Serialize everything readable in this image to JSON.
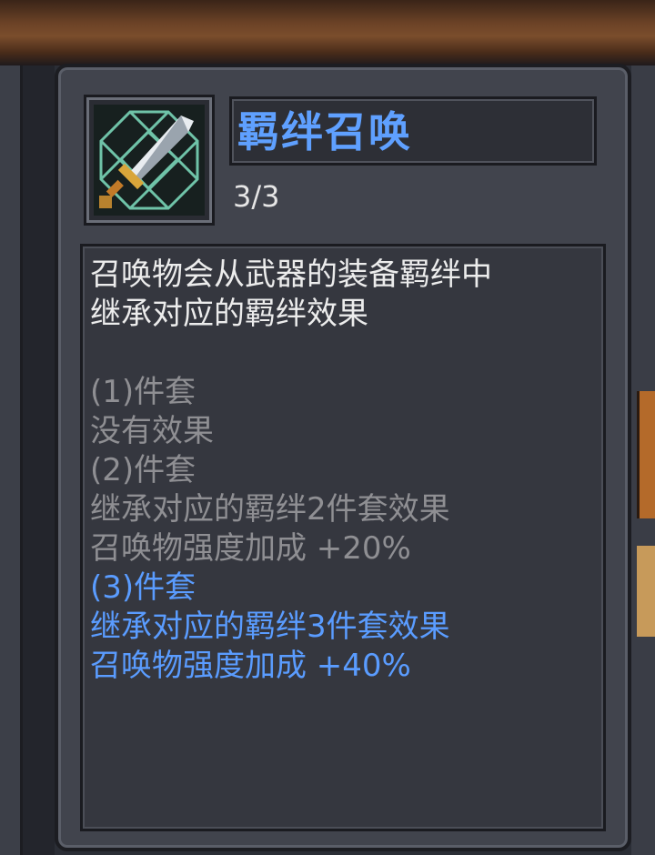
{
  "skill": {
    "icon": "sword-icon",
    "title": "羁绊召唤",
    "count": "3/3",
    "description": [
      "召唤物会从武器的装备羁绊中",
      "继承对应的羁绊效果"
    ],
    "tiers": [
      {
        "label": "(1)件套",
        "lines": [
          "没有效果"
        ],
        "active": false
      },
      {
        "label": "(2)件套",
        "lines": [
          "继承对应的羁绊2件套效果",
          "召唤物强度加成 +20%"
        ],
        "active": false
      },
      {
        "label": "(3)件套",
        "lines": [
          "继承对应的羁绊3件套效果",
          "召唤物强度加成 +40%"
        ],
        "active": true
      }
    ]
  },
  "colors": {
    "title": "#5fa0ff",
    "active": "#5a9cff",
    "inactive": "#8f8f93",
    "text": "#ececec"
  }
}
